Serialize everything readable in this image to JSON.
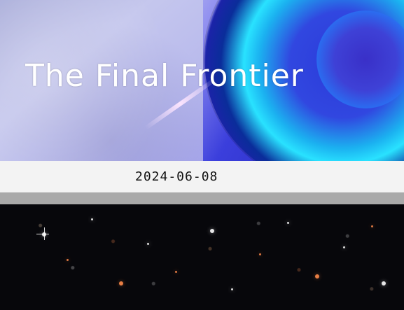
{
  "hero": {
    "title": "The Final Frontier"
  },
  "post": {
    "date": "2024-06-08"
  },
  "images": {
    "hero_icon": "planet-banner-image",
    "galaxy_icon": "deep-field-galaxy-image"
  },
  "colors": {
    "datebar_bg": "#f3f3f3",
    "divider_bg": "#a9a9a9",
    "hero_accent": "#29e2ff",
    "galaxy_bg": "#07070b"
  }
}
